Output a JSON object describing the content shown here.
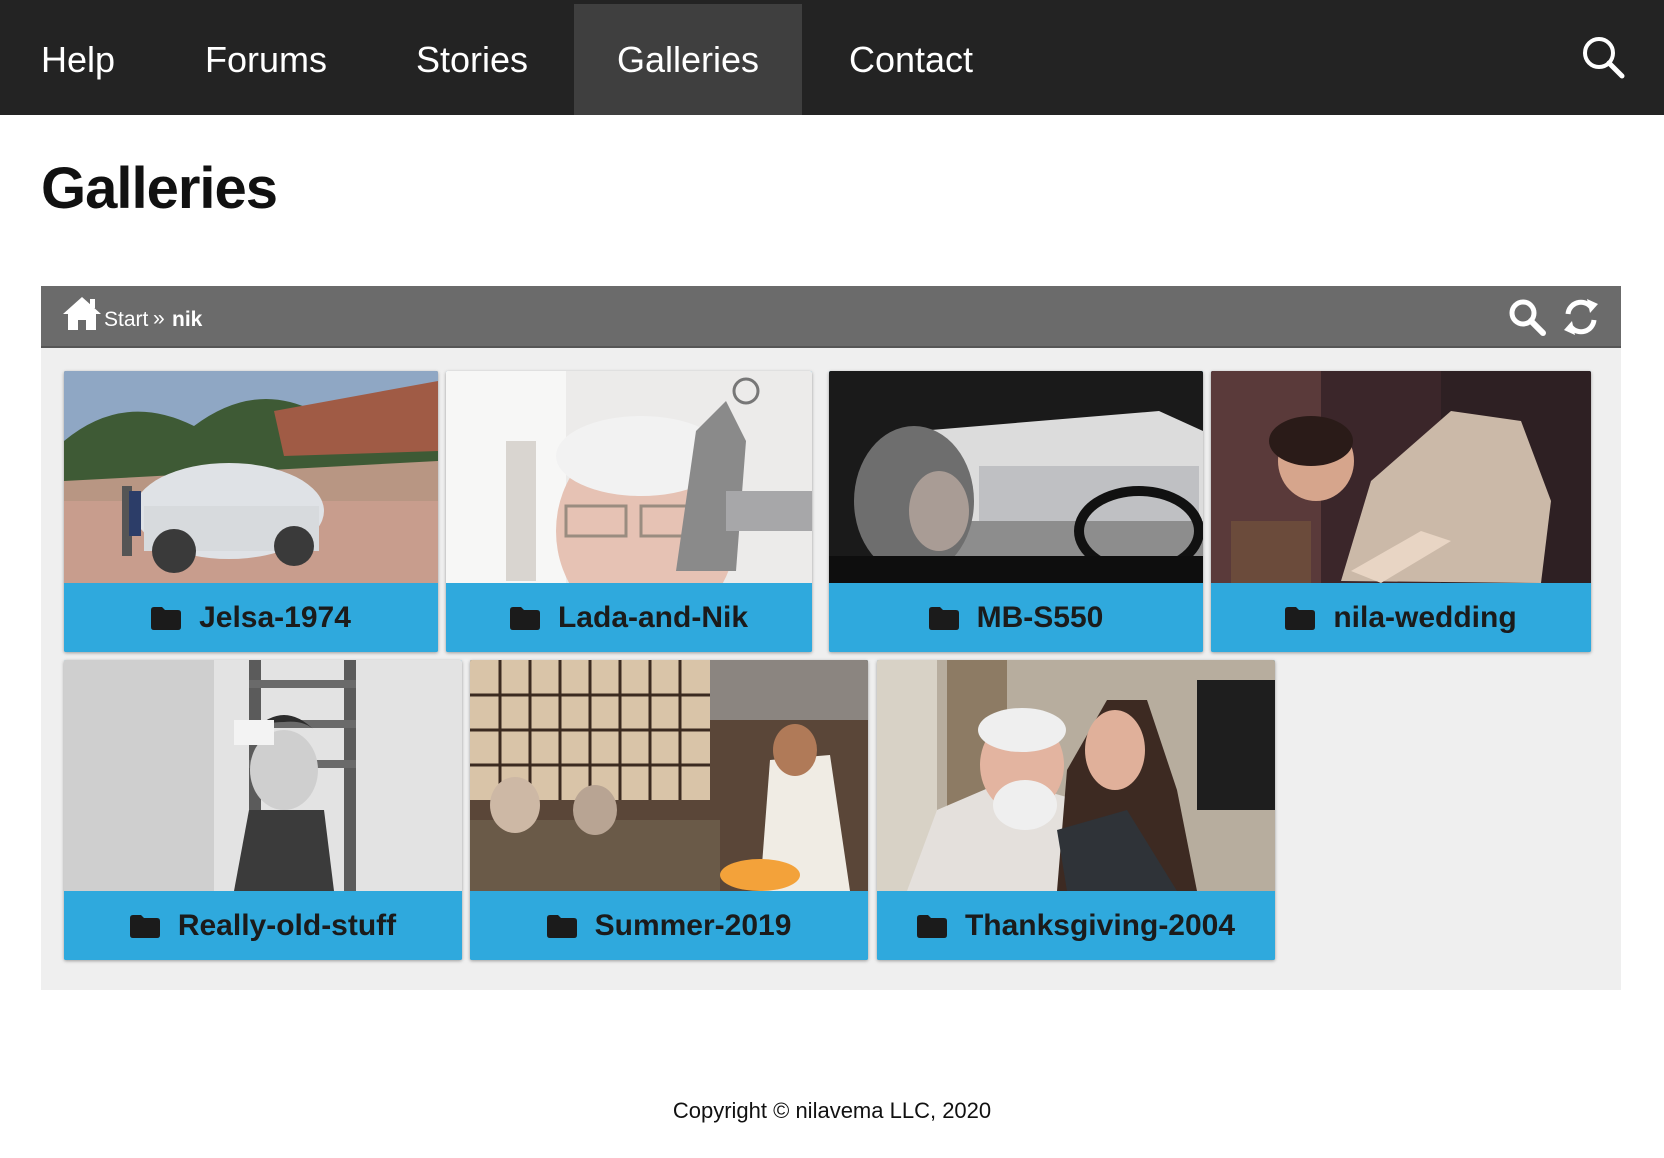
{
  "nav": {
    "items": [
      {
        "label": "Help"
      },
      {
        "label": "Forums"
      },
      {
        "label": "Stories"
      },
      {
        "label": "Galleries",
        "active": true
      },
      {
        "label": "Contact"
      }
    ],
    "search_icon": "search-icon"
  },
  "page": {
    "title": "Galleries"
  },
  "gallery": {
    "breadcrumb": {
      "home_icon": "home-icon",
      "start": "Start",
      "separator": "»",
      "current": "nik"
    },
    "toolbar_icons": [
      "search-icon",
      "refresh-icon"
    ],
    "folders": [
      {
        "name": "Jelsa-1974"
      },
      {
        "name": "Lada-and-Nik"
      },
      {
        "name": "MB-S550"
      },
      {
        "name": "nila-wedding"
      },
      {
        "name": "Really-old-stuff"
      },
      {
        "name": "Summer-2019"
      },
      {
        "name": "Thanksgiving-2004"
      }
    ],
    "caption_color": "#2fa9dd"
  },
  "footer": {
    "copyright": "Copyright © nilavema LLC, 2020"
  }
}
